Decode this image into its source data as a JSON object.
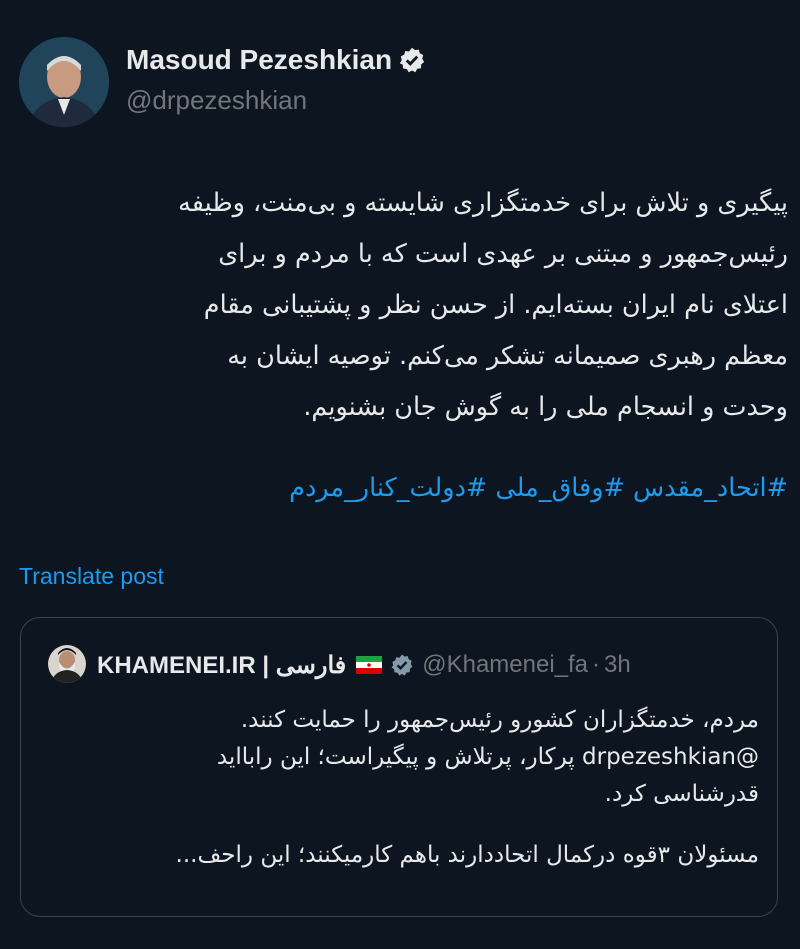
{
  "author": {
    "display_name": "Masoud Pezeshkian",
    "handle": "@drpezeshkian",
    "verified_icon": "verified-badge-icon"
  },
  "tweet": {
    "lines": [
      "پیگیری و تلاش برای خدمتگزاری شایسته و بی‌منت، وظیفه",
      "رئیس‌جمهور و مبتنی بر عهدی است که با مردم و برای",
      "اعتلای نام ایران بسته‌ایم. از حسن نظر و پشتیبانی مقام",
      "معظم رهبری صمیمانه تشکر می‌کنم. توصیه ایشان به",
      "وحدت و انسجام ملی را به گوش جان بشنویم."
    ],
    "hashtags": "#اتحاد_مقدس #وفاق_ملی #دولت_کنار_مردم"
  },
  "translate_label": "Translate post",
  "quote": {
    "name": "KHAMENEI.IR | فارسی",
    "handle": "@Khamenei_fa",
    "separator": "·",
    "time": "3h",
    "lines": [
      "مردم، خدمتگزاران کشورو رئیس‌جمهور را حمایت کنند.",
      "@drpezeshkian پرکار، پرتلاش و پیگیراست؛ این رابااید",
      "قدرشناسی کرد.",
      "",
      "مسئولان ۳قوه درکمال اتحاددارند باهم کارمیکنند؛ این راحف..."
    ]
  },
  "colors": {
    "background": "#0c1520",
    "text": "#e7e9ea",
    "muted": "#71767b",
    "accent": "#1d9bf0",
    "border": "#38444d"
  }
}
